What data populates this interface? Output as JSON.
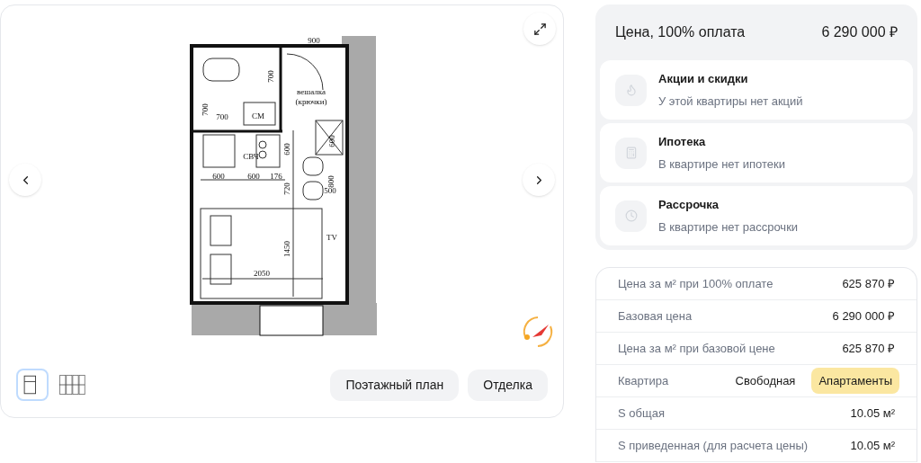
{
  "plan": {
    "labels": [
      "900",
      "700",
      "вешалка",
      "(крючки)",
      "700",
      "700",
      "СМ",
      "600",
      "600",
      "СВЧ",
      "600",
      "600",
      "176",
      "720",
      "800",
      "500",
      "TV",
      "1450",
      "2050"
    ]
  },
  "thumbnails": [
    {
      "kind": "unit",
      "selected": true
    },
    {
      "kind": "floor",
      "selected": false
    }
  ],
  "plan_buttons": [
    "Поэтажный план",
    "Отделка"
  ],
  "price": {
    "label": "Цена, 100% оплата",
    "value": "6 290 000 ₽"
  },
  "offers": [
    {
      "kind": "promo",
      "title": "Акции и скидки",
      "subtitle": "У этой квартиры нет акций"
    },
    {
      "kind": "mortgage",
      "title": "Ипотека",
      "subtitle": "В квартире нет ипотеки"
    },
    {
      "kind": "installment",
      "title": "Рассрочка",
      "subtitle": "В квартире нет рассрочки"
    }
  ],
  "details": [
    {
      "kind": "value",
      "label": "Цена за м² при 100% оплате",
      "value": "625 870 ₽"
    },
    {
      "kind": "value",
      "label": "Базовая цена",
      "value": "6 290 000 ₽"
    },
    {
      "kind": "value",
      "label": "Цена за м² при базовой цене",
      "value": "625 870 ₽"
    },
    {
      "kind": "tags",
      "label": "Квартира",
      "tags": [
        {
          "text": "Свободная",
          "highlighted": false
        },
        {
          "text": "Апартаменты",
          "highlighted": true
        }
      ]
    },
    {
      "kind": "value",
      "label": "S общая",
      "value": "10.05 м²"
    },
    {
      "kind": "value",
      "label": "S приведенная (для расчета цены)",
      "value": "10.05 м²"
    }
  ]
}
